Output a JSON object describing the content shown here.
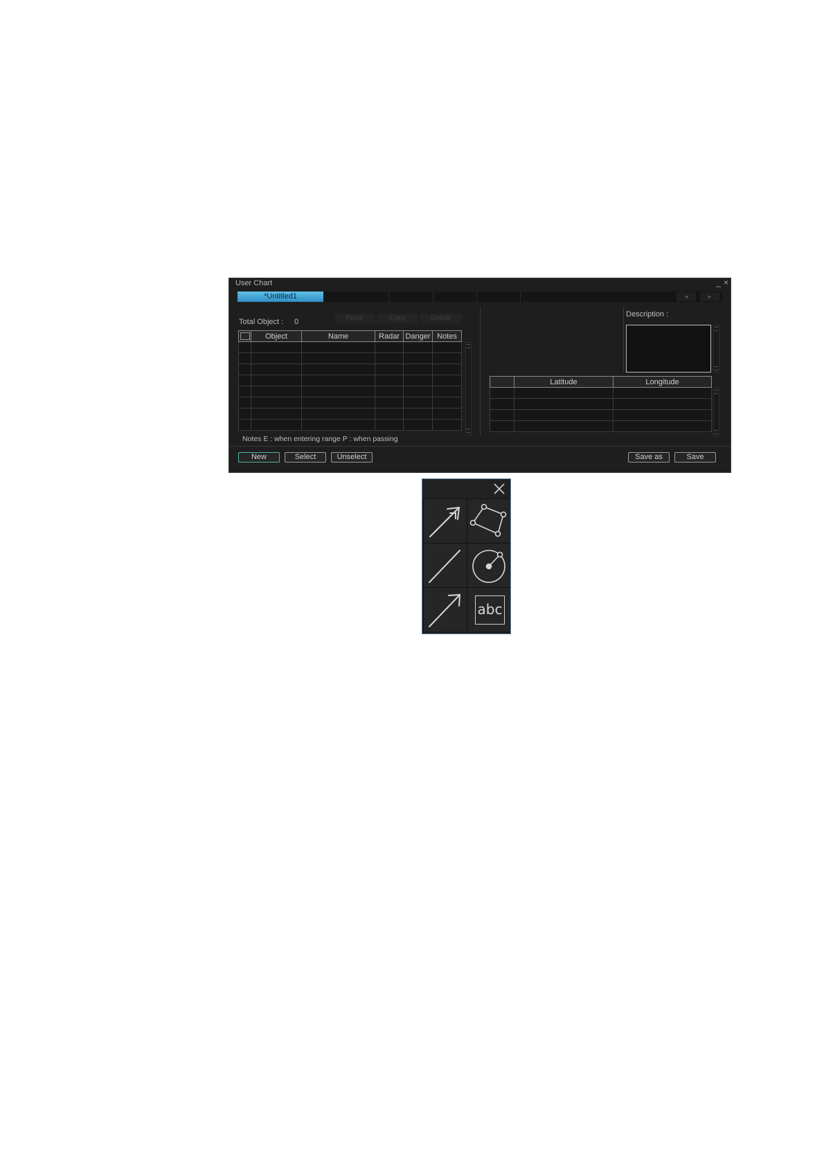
{
  "window": {
    "title": "User Chart",
    "minimize_glyph": "_",
    "close_glyph": "×",
    "active_tab": "*Untitled1",
    "tab_prev": "◄",
    "tab_next": "►"
  },
  "objects_panel": {
    "total_label": "Total Object :",
    "total_value": "0",
    "dim_buttons": [
      "Paste",
      "Copy",
      "Delete"
    ],
    "columns": [
      "Object",
      "Name",
      "Radar",
      "Danger",
      "Notes"
    ],
    "empty_rows": 8,
    "notes_text": "Notes  E : when entering range  P : when passing"
  },
  "detail_panel": {
    "description_label": "Description :",
    "columns": [
      "Latitude",
      "Longitude"
    ],
    "empty_rows": 4
  },
  "buttons": {
    "new": "New",
    "select": "Select",
    "unselect": "Unselect",
    "save_as": "Save as",
    "save": "Save"
  },
  "toolbox": {
    "tools": [
      "double-arrow-icon",
      "polygon-icon",
      "line-icon",
      "circle-icon",
      "arrow-icon",
      "text-icon"
    ],
    "text_tool_label": "abc"
  },
  "colors": {
    "window_bg": "#1e1e1e",
    "active_tab": "#3fa4d6",
    "primary_button_border": "#4fb3a8",
    "toolbox_border": "#5d7f9c"
  }
}
